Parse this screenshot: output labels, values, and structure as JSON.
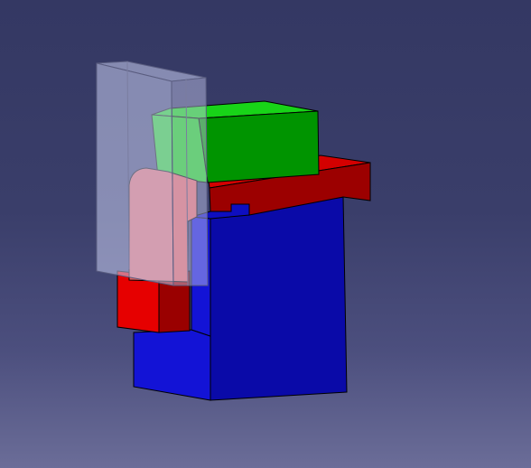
{
  "viewport": {
    "background_top": "#343863",
    "background_bottom": "#6b6d98"
  },
  "parts": {
    "blue_block": {
      "front": "#0a0aa8",
      "side": "#1313d6",
      "top": "#0e0ec0",
      "edge": "#000000"
    },
    "red_slide": {
      "front": "#9c0000",
      "side": "#e60000",
      "top": "#d40000"
    },
    "red_foot": {
      "front": "#9a0000",
      "side": "#e60000"
    },
    "green_block": {
      "front": "#009400",
      "side": "#1ed01e",
      "top": "#18d418"
    },
    "glass_housing": {
      "fill": "#c9cdf0",
      "opacity": 0.55,
      "edge": "#5a5d80"
    }
  }
}
